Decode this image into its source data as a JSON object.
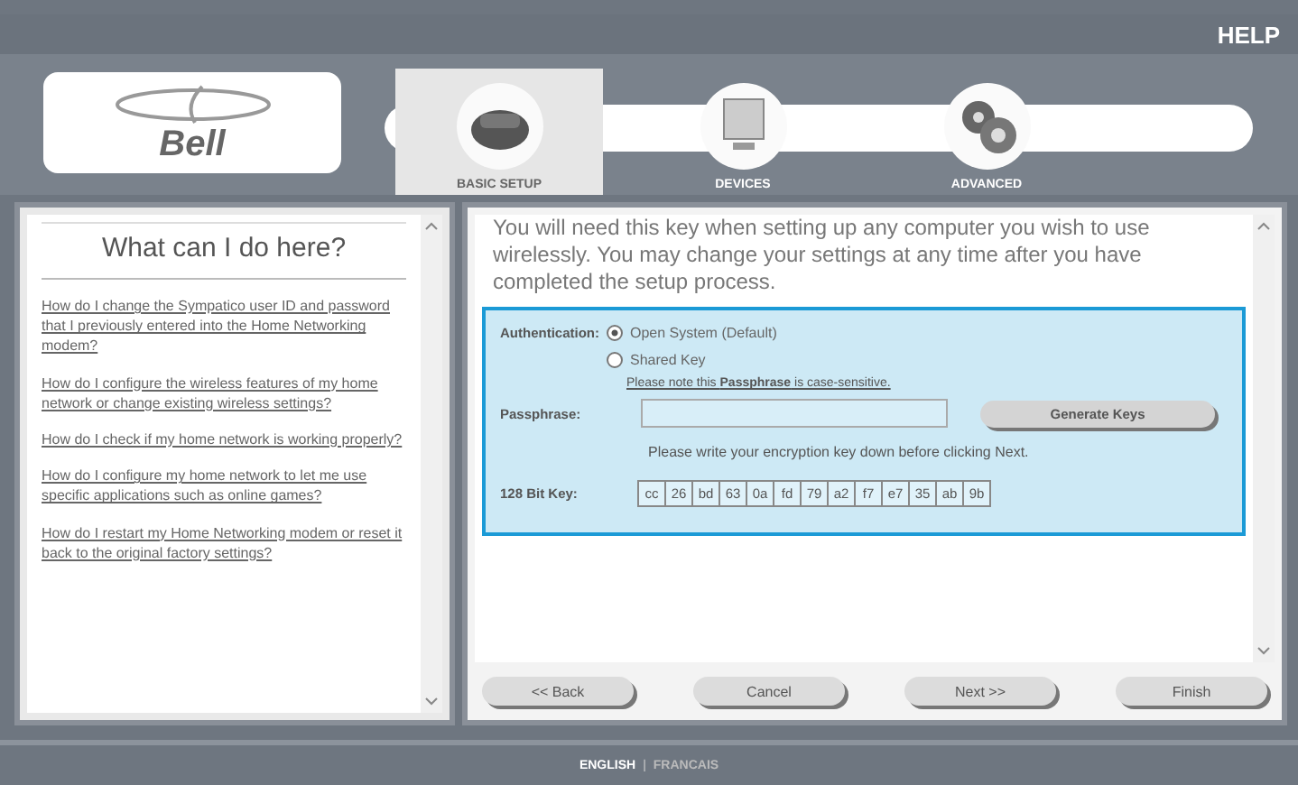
{
  "header": {
    "help": "HELP",
    "logo": "Bell"
  },
  "tabs": [
    {
      "label": "BASIC SETUP",
      "selected": true
    },
    {
      "label": "DEVICES",
      "selected": false
    },
    {
      "label": "ADVANCED",
      "selected": false
    }
  ],
  "help_panel": {
    "title": "What can I do here?",
    "links": [
      "How do I change the Sympatico user ID and password that I previously entered into the Home Networking modem?",
      "How do I configure the wireless features of my home network or change existing wireless settings?",
      "How do I check if my home network is working properly?",
      "How do I configure my home network to let me use specific applications such as online games?",
      "How do I restart my Home Networking modem or reset it back to the original factory settings?"
    ]
  },
  "intro": "You will need this key when setting up any computer you wish to use wirelessly. You may change your settings at any time after you have completed the setup process.",
  "authentication": {
    "label": "Authentication:",
    "options": [
      {
        "label": "Open System (Default)",
        "selected": true
      },
      {
        "label": "Shared Key",
        "selected": false
      }
    ]
  },
  "passphrase_note": "Please note this **Passphrase** is case-sensitive.",
  "passphrase": {
    "label": "Passphrase:"
  },
  "generate_button": "Generate Keys",
  "write_down_note": "Please write your encryption key down before clicking Next.",
  "key": {
    "label": "128 Bit Key:",
    "bytes": [
      "cc",
      "26",
      "bd",
      "63",
      "0a",
      "fd",
      "79",
      "a2",
      "f7",
      "e7",
      "35",
      "ab",
      "9b"
    ]
  },
  "buttons": [
    "<< Back",
    "Cancel",
    "Next >>",
    "Finish"
  ],
  "footer": {
    "languages": [
      {
        "label": "ENGLISH",
        "selected": true
      },
      {
        "label": "FRANCAIS",
        "selected": false
      }
    ],
    "separator": "|"
  }
}
